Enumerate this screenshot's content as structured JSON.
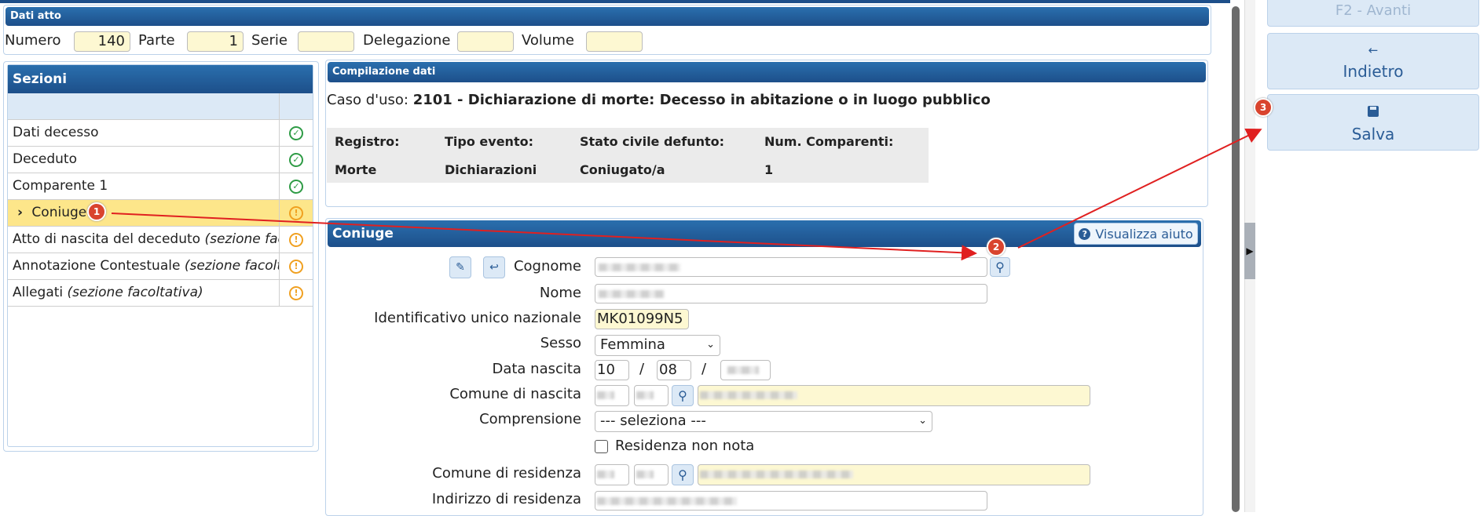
{
  "dati_atto": {
    "title": "Dati atto",
    "fields": [
      {
        "label": "Numero",
        "value": "140"
      },
      {
        "label": "Parte",
        "value": "1"
      },
      {
        "label": "Serie",
        "value": ""
      },
      {
        "label": "Delegazione",
        "value": ""
      },
      {
        "label": "Volume",
        "value": ""
      }
    ]
  },
  "sezioni": {
    "title": "Sezioni",
    "items": [
      {
        "label": "Dati decesso",
        "optional": "",
        "status": "ok"
      },
      {
        "label": "Deceduto",
        "optional": "",
        "status": "ok"
      },
      {
        "label": "Comparente 1",
        "optional": "",
        "status": "ok"
      },
      {
        "label": "Coniuge",
        "optional": "",
        "status": "warn",
        "active": true,
        "chevron": "›"
      },
      {
        "label": "Atto di nascita del deceduto",
        "optional": "(sezione facolta",
        "status": "warn"
      },
      {
        "label": "Annotazione Contestuale",
        "optional": "(sezione facoltativ",
        "status": "warn"
      },
      {
        "label": "Allegati",
        "optional": "(sezione facoltativa)",
        "status": "warn"
      }
    ]
  },
  "compilazione": {
    "title": "Compilazione dati",
    "caso_prefix": "Caso d'uso:",
    "caso_value": "2101 - Dichiarazione di morte: Decesso in abitazione o in luogo pubblico",
    "headers": [
      "Registro:",
      "Tipo evento:",
      "Stato civile defunto:",
      "Num. Comparenti:"
    ],
    "values": [
      "Morte",
      "Dichiarazioni",
      "Coniugato/a",
      "1"
    ]
  },
  "coniuge": {
    "title": "Coniuge",
    "help_label": "Visualizza aiuto",
    "cognome_label": "Cognome",
    "nome_label": "Nome",
    "id_label": "Identificativo unico nazionale",
    "id_value": "MK01099N5",
    "sesso_label": "Sesso",
    "sesso_value": "Femmina",
    "data_label": "Data nascita",
    "data_day": "10",
    "data_month": "08",
    "date_sep": "/",
    "comune_nascita_label": "Comune di nascita",
    "comprensione_label": "Comprensione",
    "comprensione_value": "--- seleziona ---",
    "residenza_nonnota_label": "Residenza non nota",
    "comune_residenza_label": "Comune di residenza",
    "indirizzo_label": "Indirizzo di residenza"
  },
  "sidebar": {
    "avanti_label": "F2 - Avanti",
    "indietro_label": "Indietro",
    "salva_label": "Salva"
  },
  "annotations": {
    "b1": "1",
    "b2": "2",
    "b3": "3"
  },
  "colors": {
    "accent": "#1d4f8a",
    "highlight": "#fde68a",
    "ok": "#2e9b45",
    "warn": "#f0a020",
    "annotation": "#d9442e"
  }
}
